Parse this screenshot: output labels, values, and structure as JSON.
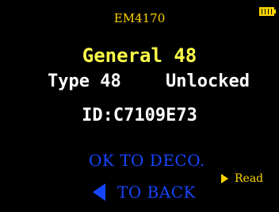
{
  "header": {
    "tag_type": "EM4170",
    "battery_icon": "battery-full-icon"
  },
  "card": {
    "title": "General 48",
    "type_label": "Type 48",
    "lock_status": "Unlocked",
    "id": "ID:C7109E73"
  },
  "actions": {
    "ok_label": "OK TO DECO.",
    "back_label": "TO BACK",
    "back_icon": "triangle-left-icon",
    "read_label": "Read",
    "read_icon": "triangle-right-icon"
  },
  "colors": {
    "background": "#000000",
    "yellow": "#ffd400",
    "title_yellow": "#ffff4a",
    "white": "#ffffff",
    "blue": "#1746ff"
  }
}
